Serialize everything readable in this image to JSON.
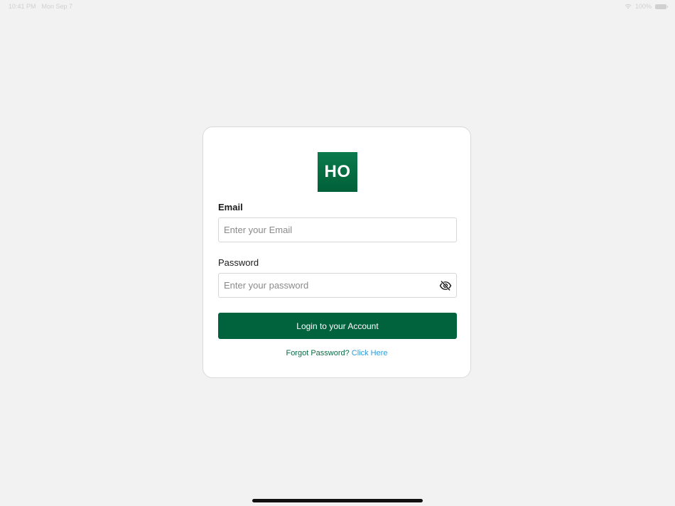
{
  "status_bar": {
    "time": "10:41 PM",
    "date": "Mon Sep 7",
    "battery": "100%"
  },
  "logo": {
    "text": "HO"
  },
  "form": {
    "email_label": "Email",
    "email_placeholder": "Enter your Email",
    "email_value": "",
    "password_label": "Password",
    "password_placeholder": "Enter your password",
    "password_value": "",
    "password_toggle_icon": "eye-slash-icon",
    "login_label": "Login to your Account",
    "forgot_text": "Forgot Password?",
    "click_here": "Click Here"
  },
  "colors": {
    "primary": "#00633e",
    "link": "#2e9bd6",
    "background": "#f2f2f2"
  }
}
